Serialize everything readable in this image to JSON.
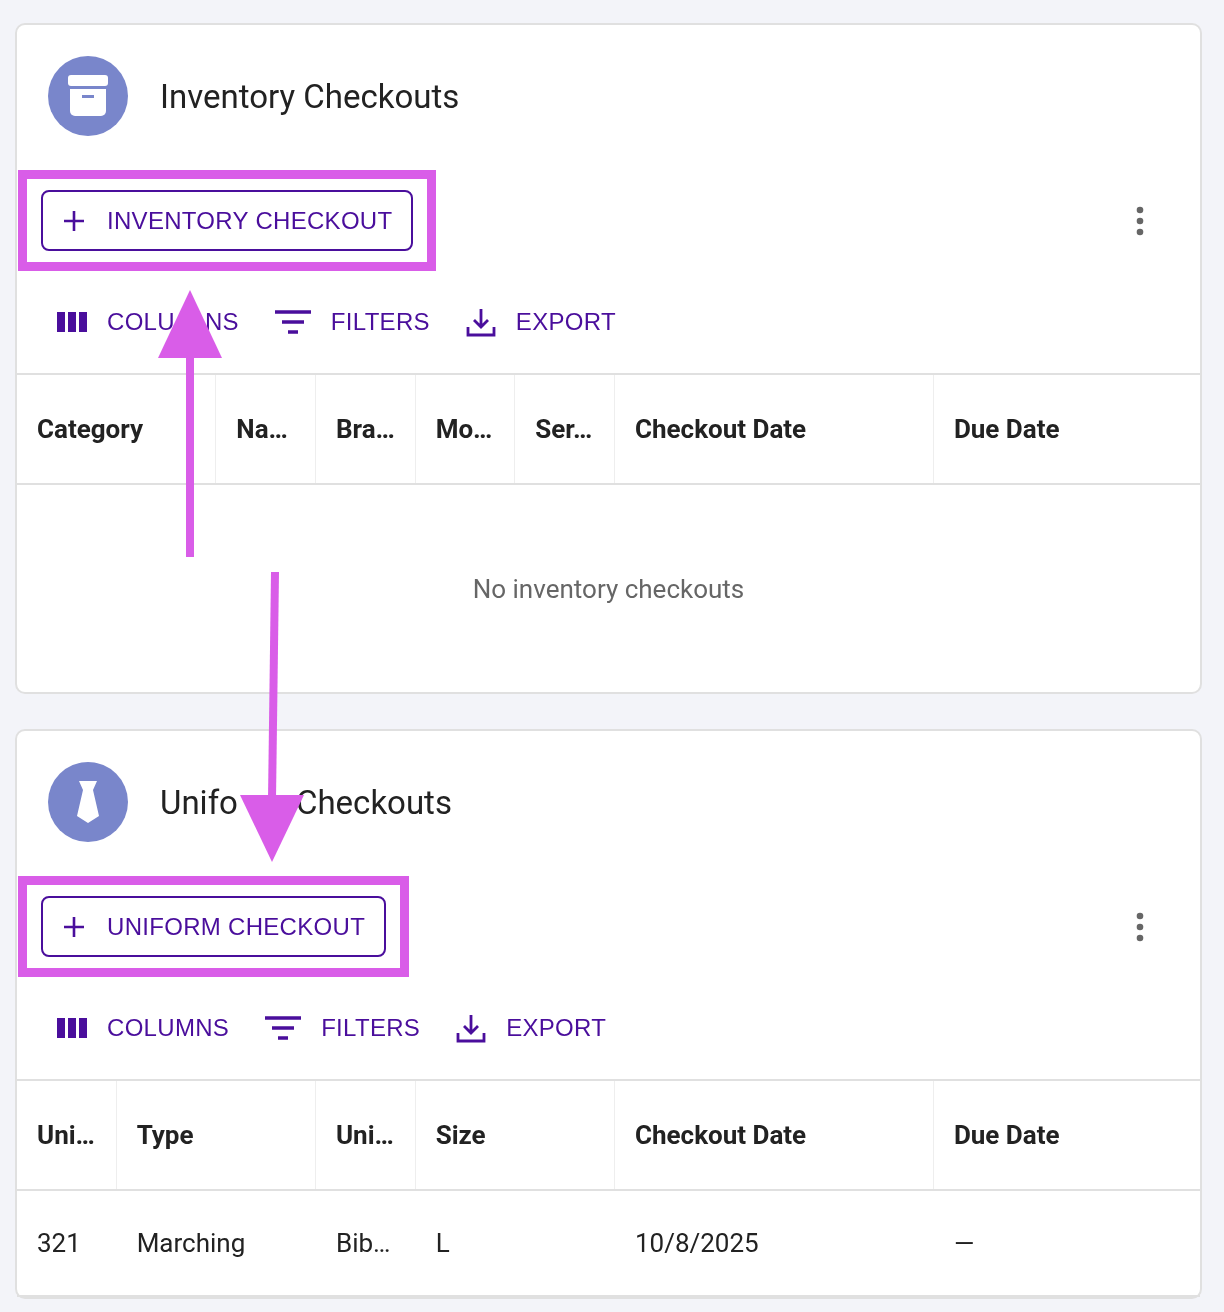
{
  "cards": [
    {
      "title": [
        "Inventory Checkouts"
      ],
      "action": {
        "label": "INVENTORY CHECKOUT",
        "highlighted": true
      },
      "toolbar": [
        [
          "COLU",
          "NS"
        ],
        [
          "FILTERS"
        ],
        [
          "EXPORT"
        ]
      ],
      "columns": [
        "Category",
        "Na…",
        "Bra…",
        "Mo…",
        "Ser…",
        "Checkout Date",
        "Due Date"
      ],
      "empty": "No inventory checkouts"
    },
    {
      "title": [
        "Unifo",
        "Checkouts"
      ],
      "action": {
        "label": "UNIFORM CHECKOUT",
        "highlighted": true
      },
      "toolbar": [
        [
          "COLUMNS"
        ],
        [
          "FILTERS"
        ],
        [
          "EXPORT"
        ]
      ],
      "columns": [
        "Uni…",
        "Type",
        "Uni…",
        "Size",
        "Checkout Date",
        "Due Date"
      ],
      "rows": [
        [
          "321",
          "Marching",
          "Bib…",
          "L",
          "10/8/2025",
          "—"
        ]
      ]
    }
  ]
}
